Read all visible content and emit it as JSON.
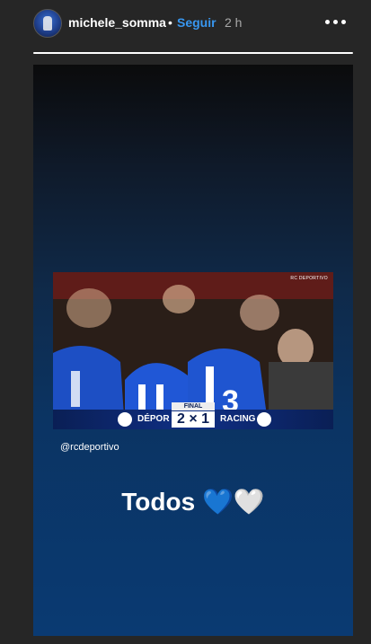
{
  "header": {
    "username": "michele_somma",
    "separator": "•",
    "follow_label": "Seguir",
    "time": "2 h"
  },
  "icons": {
    "avatar": "profile-avatar",
    "more": "more-horizontal-icon"
  },
  "story": {
    "photo": {
      "brand": "RC DEPORTIVO",
      "scoreboard": {
        "status": "FINAL",
        "home": "DÉPOR",
        "score": "2 × 1",
        "away": "RACING"
      }
    },
    "mention": "@rcdeportivo",
    "caption": "Todos 💙🤍"
  },
  "colors": {
    "follow": "#3897f0",
    "background": "#262626"
  }
}
